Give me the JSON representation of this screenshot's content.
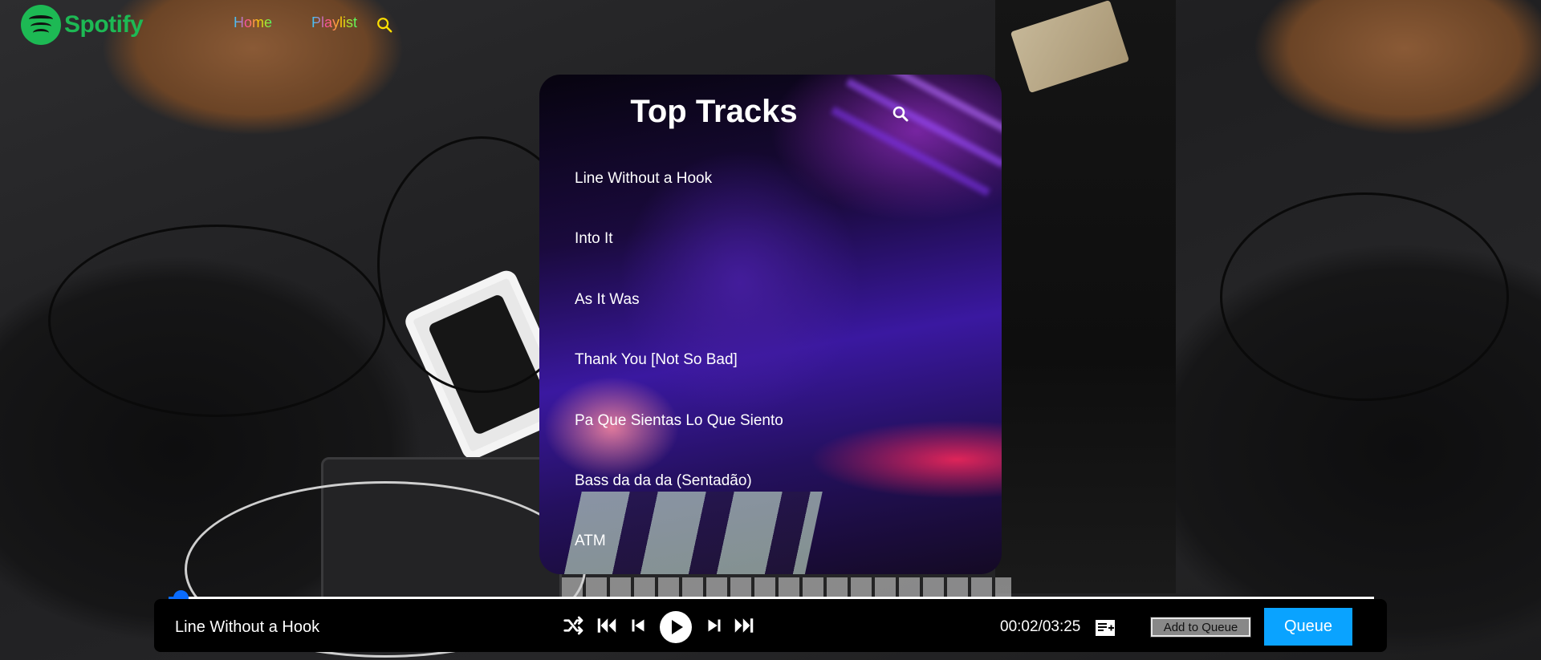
{
  "app": {
    "brand_name": "Spotify",
    "brand_color": "#1db954"
  },
  "nav": {
    "home_label": "Home",
    "playlist_label": "Playlist",
    "search_icon": "search-icon"
  },
  "top_tracks": {
    "title": "Top Tracks",
    "search_icon": "search-icon",
    "tracks": [
      "Line Without a Hook",
      "Into It",
      "As It Was",
      "Thank You [Not So Bad]",
      "Pa Que Sientas Lo Que Siento",
      "Bass da da da (Sentadão)",
      "ATM"
    ]
  },
  "player": {
    "now_playing": "Line Without a Hook",
    "elapsed": "00:02",
    "duration": "03:25",
    "time_display": "00:02/03:25",
    "progress_fraction": 0.01,
    "controls": [
      "shuffle-icon",
      "skip-back-icon",
      "previous-icon",
      "play-icon",
      "next-icon",
      "skip-forward-icon"
    ],
    "queue_icon": "playlist-add-icon",
    "add_to_queue_label": "Add to Queue",
    "queue_label": "Queue",
    "accent_color": "#0a6cff",
    "queue_button_color": "#0aa3ff"
  }
}
